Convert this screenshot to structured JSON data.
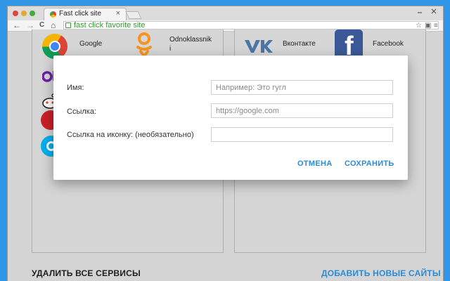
{
  "browser": {
    "tab_title": "Fast click site",
    "tab_close": "×",
    "new_tab": "",
    "address": "fast click favorite site",
    "nav": {
      "back": "←",
      "forward": "→",
      "reload": "C",
      "home": "⌂"
    }
  },
  "services": {
    "left": [
      {
        "label": "Google",
        "icon": "chrome-icon"
      },
      {
        "label": "Odnoklassnik\ni",
        "icon": "odnoklassniki-icon"
      }
    ],
    "right": [
      {
        "label": "Вконтакте",
        "icon": "vk-icon"
      },
      {
        "label": "Facebook",
        "icon": "facebook-icon"
      }
    ]
  },
  "dialog": {
    "name_label": "Имя:",
    "name_placeholder": "Например: Это гугл",
    "link_label": "Ссылка:",
    "link_placeholder": "https://google.com",
    "icon_label": "Ссылка на иконку: (необязательно)",
    "icon_placeholder": "",
    "cancel": "ОТМЕНА",
    "save": "СОХРАНИТЬ"
  },
  "footer": {
    "delete_all": "УДАЛИТЬ ВСЕ СЕРВИСЫ",
    "add_new": "ДОБАВИТЬ НОВЫЕ САЙТЫ"
  },
  "colors": {
    "background": "#2f96e8",
    "accent": "#2b8bd6",
    "url_green": "#2f9a2f",
    "vk_blue": "#4a76a8",
    "facebook_blue": "#3b5998",
    "ok_orange": "#f7931e"
  }
}
